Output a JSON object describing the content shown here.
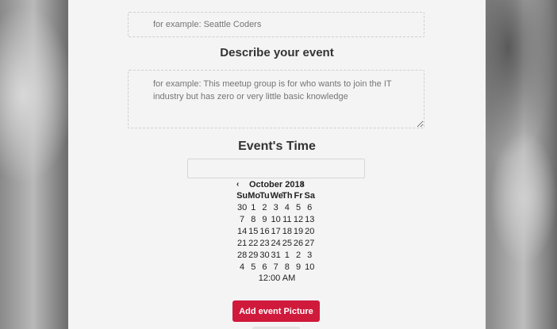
{
  "form": {
    "name_placeholder": "for example: Seattle Coders",
    "describe_heading": "Describe your event",
    "describe_placeholder": "for example: This meetup group is for who wants to join the IT industry but has zero or very little basic knowledge",
    "time_heading": "Event's Time",
    "time_value": ""
  },
  "calendar": {
    "prev_label": "‹",
    "next_label": "›",
    "month_label": "October 2018",
    "weekdays": [
      "Su",
      "Mo",
      "Tu",
      "We",
      "Th",
      "Fr",
      "Sa"
    ],
    "weeks": [
      [
        "30",
        "1",
        "2",
        "3",
        "4",
        "5",
        "6"
      ],
      [
        "7",
        "8",
        "9",
        "10",
        "11",
        "12",
        "13"
      ],
      [
        "14",
        "15",
        "16",
        "17",
        "18",
        "19",
        "20"
      ],
      [
        "21",
        "22",
        "23",
        "24",
        "25",
        "26",
        "27"
      ],
      [
        "28",
        "29",
        "30",
        "31",
        "1",
        "2",
        "3"
      ],
      [
        "4",
        "5",
        "6",
        "7",
        "8",
        "9",
        "10"
      ]
    ],
    "time_label": "12:00 AM"
  },
  "actions": {
    "add_picture_label": "Add event Picture"
  },
  "colors": {
    "accent": "#d01a3c",
    "panel": "#f4f4f4"
  }
}
